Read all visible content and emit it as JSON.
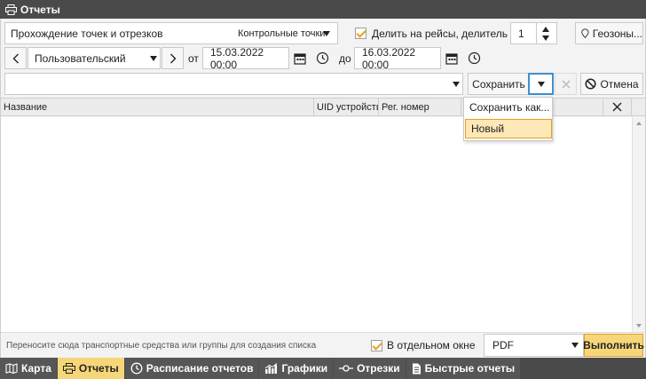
{
  "window": {
    "title": "Отчеты"
  },
  "toolbar": {
    "report_type": "Прохождение точек и отрезков",
    "report_subtype": "Контрольные точки",
    "split_trips_label": "Делить на рейсы, делитель №",
    "divider_value": "1",
    "geofences_label": "Геозоны...",
    "period_preset": "Пользовательский",
    "from_label": "от",
    "from_value": "15.03.2022 00:00",
    "to_label": "до",
    "to_value": "16.03.2022 00:00",
    "template_value": "",
    "save_label": "Сохранить",
    "cancel_label": "Отмена"
  },
  "save_menu": {
    "items": [
      {
        "label": "Сохранить как..."
      },
      {
        "label": "Новый"
      }
    ]
  },
  "grid": {
    "columns": [
      "Название",
      "UID устройства",
      "Рег. номер",
      ""
    ]
  },
  "footer": {
    "hint": "Переносите сюда транспортные средства или группы для создания списка",
    "separate_window_label": "В отдельном окне",
    "format_value": "PDF",
    "run_label": "Выполнить"
  },
  "tabs": [
    {
      "label": "Карта",
      "icon": "map-icon"
    },
    {
      "label": "Отчеты",
      "icon": "printer-icon",
      "active": true
    },
    {
      "label": "Расписание отчетов",
      "icon": "clock-icon"
    },
    {
      "label": "Графики",
      "icon": "chart-icon"
    },
    {
      "label": "Отрезки",
      "icon": "segment-icon"
    },
    {
      "label": "Быстрые отчеты",
      "icon": "document-icon"
    }
  ],
  "colors": {
    "accent": "#e6a020",
    "active_tab": "#f7d67a",
    "titlebar": "#4a4a4a"
  }
}
